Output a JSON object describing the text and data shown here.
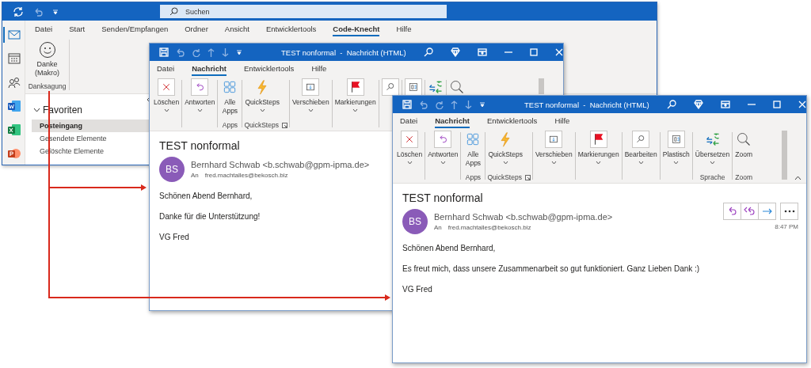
{
  "main_window": {
    "app_bar": [
      {
        "selected": true
      },
      {
        "selected": false
      },
      {
        "selected": false
      },
      {
        "selected": false
      },
      {
        "selected": false
      },
      {
        "selected": false
      }
    ],
    "search": {
      "placeholder": "Suchen"
    },
    "tabs": [
      {
        "label": "Datei",
        "selected": false
      },
      {
        "label": "Start",
        "selected": false
      },
      {
        "label": "Senden/Empfangen",
        "selected": false
      },
      {
        "label": "Ordner",
        "selected": false
      },
      {
        "label": "Ansicht",
        "selected": false
      },
      {
        "label": "Entwicklertools",
        "selected": false
      },
      {
        "label": "Code-Knecht",
        "selected": true
      },
      {
        "label": "Hilfe",
        "selected": false
      }
    ],
    "ribbon": {
      "button": "Danke (Makro)",
      "group": "Danksagung"
    },
    "folder_pane": {
      "header": "Favoriten",
      "expanded": true,
      "folders": [
        {
          "label": "Posteingang",
          "selected": true
        },
        {
          "label": "Gesendete Elemente",
          "selected": false
        },
        {
          "label": "Gelöschte Elemente",
          "selected": false
        }
      ]
    }
  },
  "message_windows": [
    {
      "title": "TEST nonformal  -  Nachricht (HTML)",
      "tabs": [
        {
          "label": "Datei",
          "selected": false
        },
        {
          "label": "Nachricht",
          "selected": true
        },
        {
          "label": "Entwicklertools",
          "selected": false
        },
        {
          "label": "Hilfe",
          "selected": false
        }
      ],
      "ribbon_groups": [
        {
          "buttons": [
            {
              "label": "Löschen",
              "dropdown": true
            }
          ]
        },
        {
          "buttons": [
            {
              "label": "Antworten",
              "dropdown": true
            }
          ]
        },
        {
          "label": "Apps",
          "buttons": [
            {
              "label": "Alle Apps",
              "dropdown": false
            }
          ]
        },
        {
          "label": "QuickSteps",
          "launcher": true,
          "buttons": [
            {
              "label": "QuickSteps",
              "dropdown": true
            }
          ]
        },
        {
          "buttons": [
            {
              "label": "Verschieben",
              "dropdown": true
            }
          ]
        },
        {
          "buttons": [
            {
              "label": "Markierungen",
              "dropdown": true
            }
          ]
        },
        {
          "buttons": [
            {
              "dropdown": false
            }
          ]
        },
        {
          "buttons": [
            {
              "dropdown": false
            }
          ]
        },
        {
          "buttons": [
            {
              "dropdown": false
            }
          ]
        },
        {
          "buttons": [
            {
              "dropdown": false
            }
          ]
        }
      ],
      "message": {
        "subject": "TEST nonformal",
        "initials": "BS",
        "sender": "Bernhard Schwab <b.schwab@gpm-ipma.de>",
        "to_label": "An",
        "to": "fred.machtalles@bekosch.biz",
        "body": [
          "Schönen Abend Bernhard,",
          "Danke für die Unterstützung!",
          "VG Fred"
        ]
      }
    },
    {
      "title": "TEST nonformal  -  Nachricht (HTML)",
      "tabs": [
        {
          "label": "Datei",
          "selected": false
        },
        {
          "label": "Nachricht",
          "selected": true
        },
        {
          "label": "Entwicklertools",
          "selected": false
        },
        {
          "label": "Hilfe",
          "selected": false
        }
      ],
      "ribbon_groups": [
        {
          "buttons": [
            {
              "label": "Löschen",
              "dropdown": true
            }
          ]
        },
        {
          "buttons": [
            {
              "label": "Antworten",
              "dropdown": true
            }
          ]
        },
        {
          "label": "Apps",
          "buttons": [
            {
              "label": "Alle Apps",
              "dropdown": false
            }
          ]
        },
        {
          "label": "QuickSteps",
          "launcher": true,
          "buttons": [
            {
              "label": "QuickSteps",
              "dropdown": true
            }
          ]
        },
        {
          "buttons": [
            {
              "label": "Verschieben",
              "dropdown": true
            }
          ]
        },
        {
          "buttons": [
            {
              "label": "Markierungen",
              "dropdown": true
            }
          ]
        },
        {
          "buttons": [
            {
              "label": "Bearbeiten",
              "dropdown": true
            }
          ]
        },
        {
          "buttons": [
            {
              "label": "Plastisch",
              "dropdown": true
            }
          ]
        },
        {
          "label": "Sprache",
          "buttons": [
            {
              "label": "Übersetzen",
              "dropdown": true
            }
          ]
        },
        {
          "label": "Zoom",
          "buttons": [
            {
              "label": "Zoom",
              "dropdown": false
            }
          ]
        }
      ],
      "message": {
        "subject": "TEST nonformal",
        "initials": "BS",
        "sender": "Bernhard Schwab <b.schwab@gpm-ipma.de>",
        "to_label": "An",
        "to": "fred.machtalles@bekosch.biz",
        "actions_visible": true,
        "time": "8:47 PM",
        "body": [
          "Schönen Abend Bernhard,",
          "Es freut mich, dass unsere Zusammenarbeit so gut funktioniert. Ganz Lieben Dank :)",
          "VG Fred"
        ]
      }
    }
  ]
}
